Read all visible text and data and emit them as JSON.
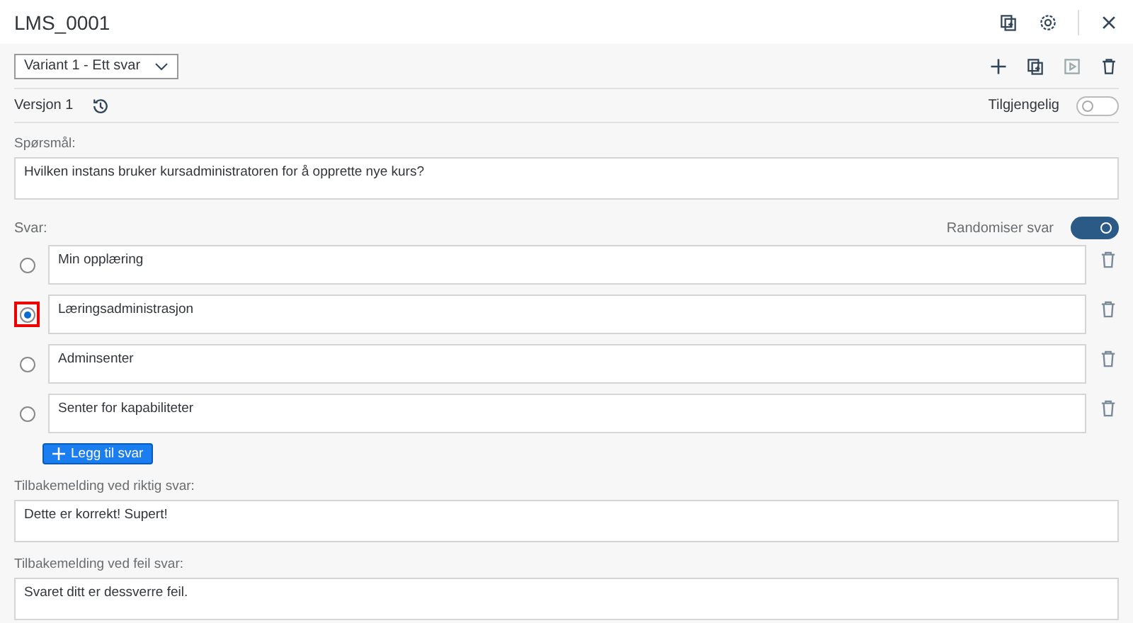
{
  "window": {
    "title": "LMS_0001"
  },
  "variant": {
    "value": "Variant 1 - Ett svar"
  },
  "version": {
    "label": "Versjon 1"
  },
  "available": {
    "label": "Tilgjengelig",
    "on": false
  },
  "question": {
    "label": "Spørsmål:",
    "value": "Hvilken instans bruker kursadministratoren for å opprette nye kurs?"
  },
  "answers_label": "Svar:",
  "randomize": {
    "label": "Randomiser svar",
    "on": true
  },
  "answers": [
    {
      "value": "Min opplæring",
      "selected": false,
      "highlighted": false
    },
    {
      "value": "Læringsadministrasjon",
      "selected": true,
      "highlighted": true
    },
    {
      "value": "Adminsenter",
      "selected": false,
      "highlighted": false
    },
    {
      "value": "Senter for kapabiliteter",
      "selected": false,
      "highlighted": false
    }
  ],
  "add_button": {
    "label": "Legg til svar"
  },
  "feedback": [
    {
      "label": "Tilbakemelding ved riktig svar:",
      "value": "Dette er korrekt! Supert!"
    },
    {
      "label": "Tilbakemelding ved feil svar:",
      "value": "Svaret ditt er dessverre feil."
    }
  ]
}
